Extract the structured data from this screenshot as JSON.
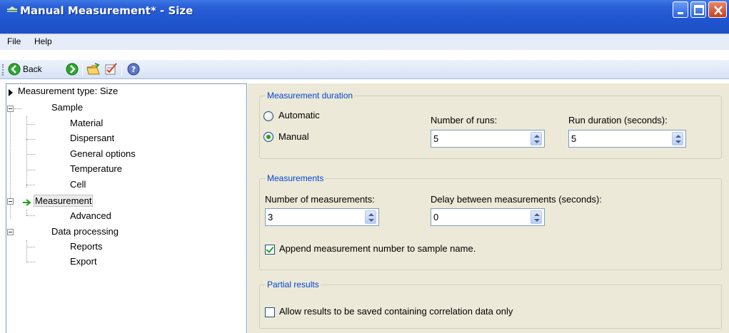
{
  "window": {
    "title": "Manual Measurement* - Size"
  },
  "menu": {
    "file": "File",
    "help": "Help"
  },
  "toolbar": {
    "back_label": "Back",
    "icons": [
      "back-arrow-icon",
      "forward-arrow-icon",
      "open-folder-icon",
      "checklist-icon",
      "help-icon"
    ]
  },
  "tree": {
    "measurement_type": "Measurement type: Size",
    "sample": "Sample",
    "material": "Material",
    "dispersant": "Dispersant",
    "general_options": "General options",
    "temperature": "Temperature",
    "cell": "Cell",
    "measurement": "Measurement",
    "advanced": "Advanced",
    "data_processing": "Data processing",
    "reports": "Reports",
    "export": "Export",
    "selected": "Measurement"
  },
  "duration": {
    "legend": "Measurement duration",
    "automatic": "Automatic",
    "manual": "Manual",
    "selected": "Manual",
    "runs_label": "Number of runs:",
    "runs_value": "5",
    "run_duration_label": "Run duration (seconds):",
    "run_duration_value": "5"
  },
  "measurements": {
    "legend": "Measurements",
    "count_label": "Number of measurements:",
    "count_value": "3",
    "delay_label": "Delay between measurements (seconds):",
    "delay_value": "0",
    "append_label": "Append measurement number to sample name.",
    "append_checked": true
  },
  "partial": {
    "legend": "Partial results",
    "allow_label": "Allow results to be saved containing correlation data only",
    "allow_checked": false
  },
  "colors": {
    "titlebar": "#2a5fd6",
    "panel": "#ece9d8",
    "legend_text": "#0046d5"
  }
}
